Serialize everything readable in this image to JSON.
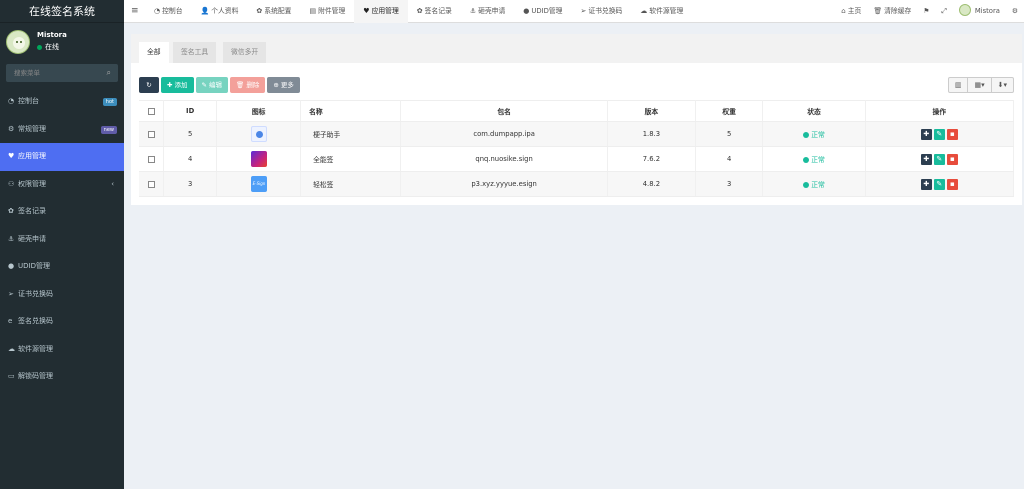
{
  "app": {
    "title": "在线签名系统"
  },
  "user": {
    "name": "Mistora",
    "status": "在线"
  },
  "search": {
    "placeholder": "搜索菜单"
  },
  "sidebar": {
    "items": [
      {
        "label": "控制台",
        "icon": "dashboard-icon",
        "badge": "hot"
      },
      {
        "label": "常规管理",
        "icon": "cogs-icon",
        "badge": "new"
      },
      {
        "label": "应用管理",
        "icon": "heart-icon",
        "active": true
      },
      {
        "label": "权限管理",
        "icon": "group-icon",
        "chevron": "‹"
      },
      {
        "label": "签名记录",
        "icon": "gear-icon"
      },
      {
        "label": "砸壳申请",
        "icon": "anchor-icon"
      },
      {
        "label": "UDID管理",
        "icon": "apple-icon"
      },
      {
        "label": "证书兑换码",
        "icon": "paper-plane-icon"
      },
      {
        "label": "签名兑换码",
        "icon": "edge-icon"
      },
      {
        "label": "软件源管理",
        "icon": "cloud-icon"
      },
      {
        "label": "解锁码管理",
        "icon": "keyboard-icon"
      }
    ]
  },
  "topbar": {
    "tabs": [
      {
        "label": "控制台",
        "icon": "dashboard-icon"
      },
      {
        "label": "个人资料",
        "icon": "user-icon"
      },
      {
        "label": "系统配置",
        "icon": "gear-icon"
      },
      {
        "label": "附件管理",
        "icon": "file-icon"
      },
      {
        "label": "应用管理",
        "icon": "heart-icon",
        "active": true
      },
      {
        "label": "签名记录",
        "icon": "gear-icon"
      },
      {
        "label": "砸壳申请",
        "icon": "anchor-icon"
      },
      {
        "label": "UDID管理",
        "icon": "apple-icon"
      },
      {
        "label": "证书兑换码",
        "icon": "paper-plane-icon"
      },
      {
        "label": "软件源管理",
        "icon": "cloud-icon"
      }
    ],
    "home": "主页",
    "clear_cache": "清除缓存",
    "username": "Mistora"
  },
  "subtabs": [
    "全部",
    "签名工具",
    "微信多开"
  ],
  "toolbar": {
    "add": "添加",
    "edit": "编辑",
    "delete": "删除",
    "more": "更多"
  },
  "table": {
    "headers": {
      "id": "ID",
      "icon": "图标",
      "name": "名称",
      "package": "包名",
      "version": "版本",
      "weight": "权重",
      "status": "状态",
      "actions": "操作"
    },
    "rows": [
      {
        "id": "5",
        "name": "梗子助手",
        "package": "com.dumpapp.ipa",
        "version": "1.8.3",
        "weight": "5",
        "status": "正常",
        "icon": "ic-1"
      },
      {
        "id": "4",
        "name": "全能签",
        "package": "qnq.nuosike.sign",
        "version": "7.6.2",
        "weight": "4",
        "status": "正常",
        "icon": "ic-2"
      },
      {
        "id": "3",
        "name": "轻松签",
        "package": "p3.xyz.yyyue.esign",
        "version": "4.8.2",
        "weight": "3",
        "status": "正常",
        "icon": "ic-3",
        "icon_text": "E-Sign"
      }
    ]
  },
  "colors": {
    "sidebar_bg": "#222d32",
    "active_menu": "#4e6ef2",
    "success": "#18bc9c",
    "danger": "#e74c3c",
    "dark": "#2c3e50"
  }
}
